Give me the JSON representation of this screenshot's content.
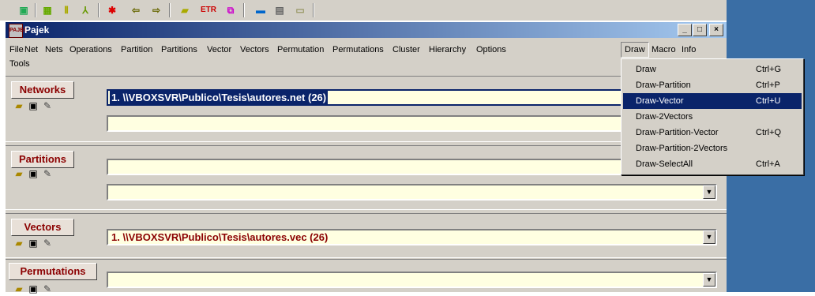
{
  "window": {
    "title": "Pajek",
    "app_icon_text": "PAJEK"
  },
  "title_buttons": {
    "minimize": "_",
    "maximize": "□",
    "close": "×"
  },
  "menu": [
    "File",
    "Net",
    "Nets",
    "Operations",
    "Partition",
    "Partitions",
    "Vector",
    "Vectors",
    "Permutation",
    "Permutations",
    "Cluster",
    "Hierarchy",
    "Options",
    "Draw",
    "Macro",
    "Info"
  ],
  "menu2": [
    "Tools"
  ],
  "sections": {
    "networks": {
      "label": "Networks",
      "field1": "1. \\\\VBOXSVR\\Publico\\Tesis\\autores.net (26)",
      "field2": ""
    },
    "partitions": {
      "label": "Partitions",
      "field1": "",
      "field2": ""
    },
    "vectors": {
      "label": "Vectors",
      "field1": "1. \\\\VBOXSVR\\Publico\\Tesis\\autores.vec (26)"
    },
    "permutations": {
      "label": "Permutations",
      "field1": ""
    }
  },
  "draw_menu": [
    {
      "label": "Draw",
      "shortcut": "Ctrl+G"
    },
    {
      "label": "Draw-Partition",
      "shortcut": "Ctrl+P"
    },
    {
      "label": "Draw-Vector",
      "shortcut": "Ctrl+U"
    },
    {
      "label": "Draw-2Vectors",
      "shortcut": ""
    },
    {
      "label": "Draw-Partition-Vector",
      "shortcut": "Ctrl+Q"
    },
    {
      "label": "Draw-Partition-2Vectors",
      "shortcut": ""
    },
    {
      "label": "Draw-SelectAll",
      "shortcut": "Ctrl+A"
    }
  ],
  "highlighted_menu_item": "Draw-Vector",
  "colors": {
    "title_bar": "#0a246a",
    "field_bg": "#ffffe1",
    "label_red": "#8b0000",
    "desktop": "#3a6ea5"
  }
}
